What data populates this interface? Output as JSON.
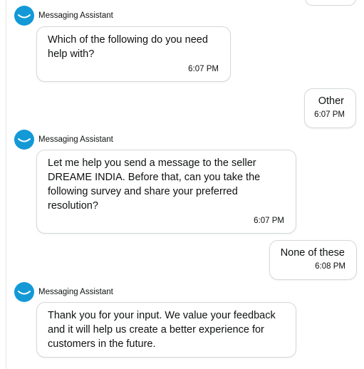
{
  "assistant": {
    "name": "Messaging Assistant"
  },
  "messages": [
    {
      "from": "assistant",
      "text": "Which of the following do you need help with?",
      "time": "6:07 PM"
    },
    {
      "from": "user",
      "text": "Other",
      "time": "6:07 PM"
    },
    {
      "from": "assistant",
      "text": "Let me help you send a message to the seller DREAME INDIA. Before that, can you take the following survey and share your preferred resolution?",
      "time": "6:07 PM"
    },
    {
      "from": "user",
      "text": "None of these",
      "time": "6:08 PM"
    },
    {
      "from": "assistant",
      "text": "Thank you for your input. We value your feedback and it will help us create a better experience for customers in the future."
    }
  ],
  "colors": {
    "avatar": "#1399d6",
    "bubble_border": "#d5d9d9",
    "text": "#0f1111"
  },
  "icons": {
    "avatar": "smile-avatar-icon"
  }
}
